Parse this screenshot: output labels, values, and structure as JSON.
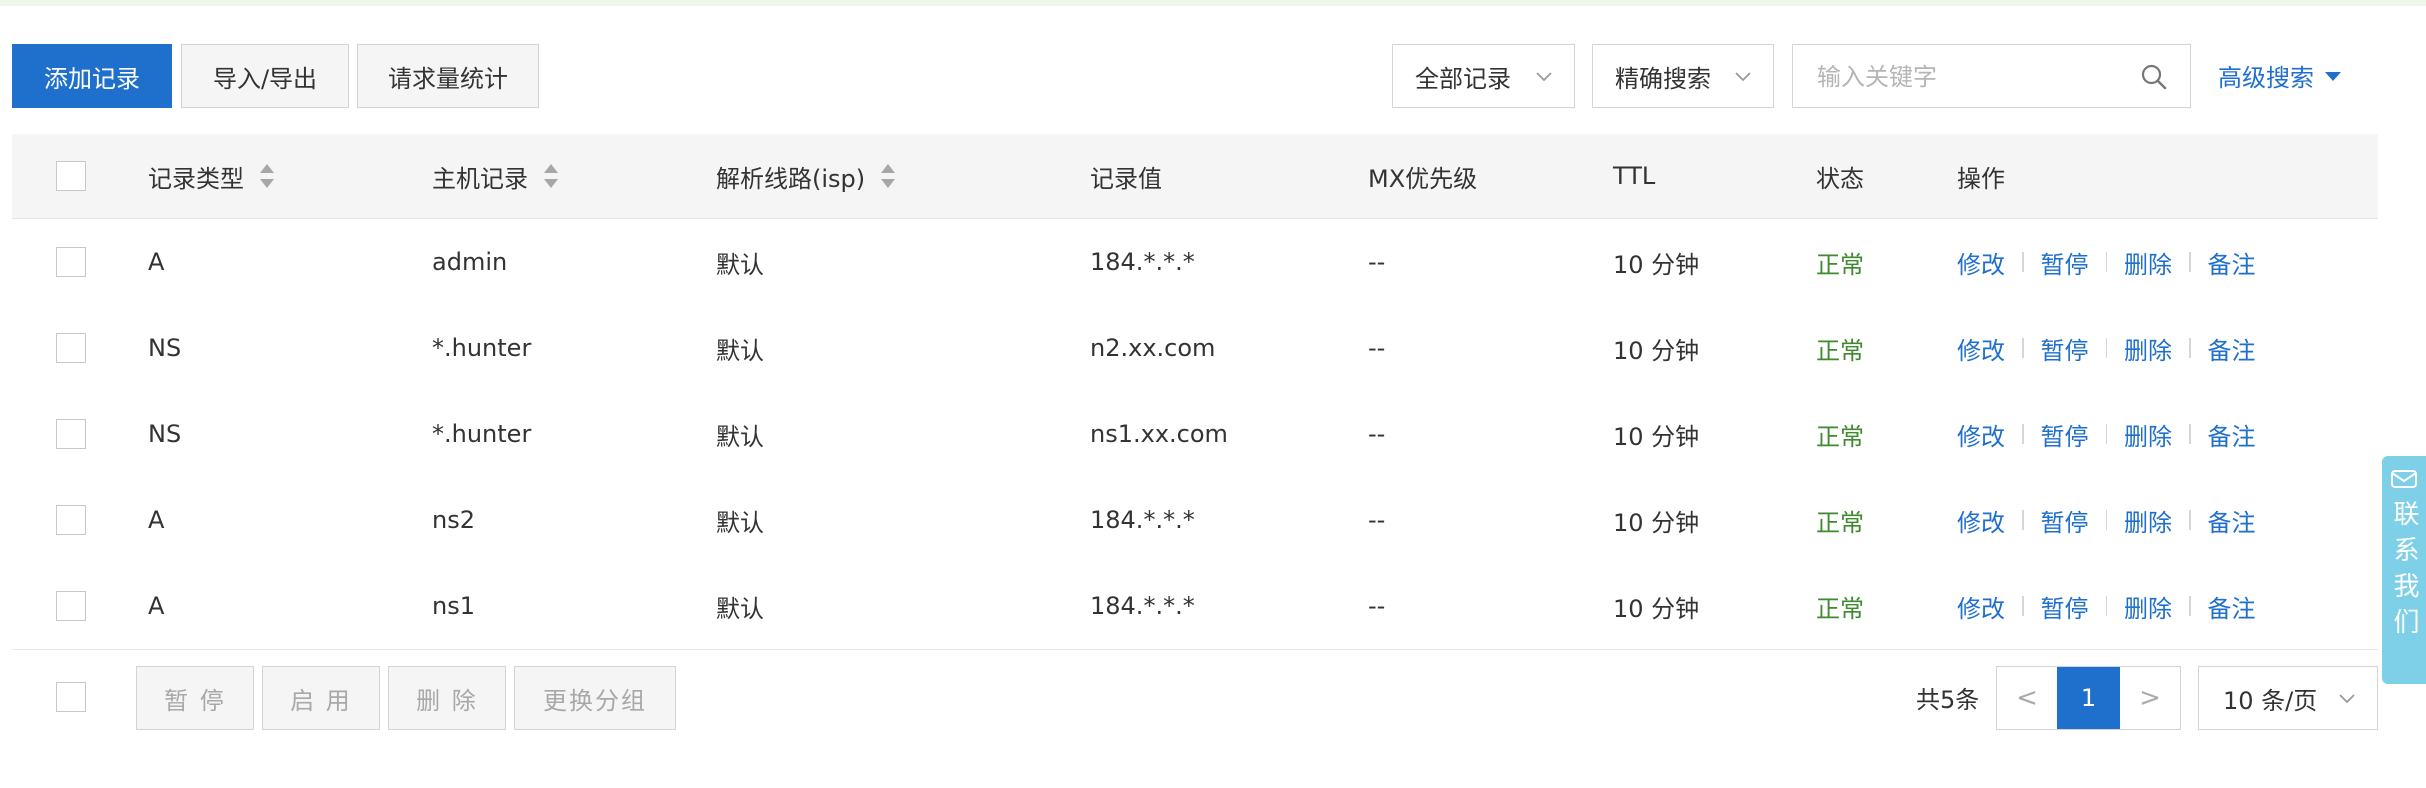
{
  "toolbar": {
    "add_label": "添加记录",
    "import_export_label": "导入/导出",
    "stats_label": "请求量统计",
    "filter_all": "全部记录",
    "filter_mode": "精确搜索",
    "search_placeholder": "输入关键字",
    "advanced_search": "高级搜索"
  },
  "table": {
    "headers": {
      "type": "记录类型",
      "host": "主机记录",
      "line": "解析线路(isp)",
      "value": "记录值",
      "mx": "MX优先级",
      "ttl": "TTL",
      "status": "状态",
      "ops": "操作"
    },
    "rows": [
      {
        "type": "A",
        "host": "admin",
        "line": "默认",
        "value": "184.*.*.*",
        "mx": "--",
        "ttl": "10 分钟",
        "status": "正常"
      },
      {
        "type": "NS",
        "host": "*.hunter",
        "line": "默认",
        "value": "n2.xx.com",
        "mx": "--",
        "ttl": "10 分钟",
        "status": "正常"
      },
      {
        "type": "NS",
        "host": "*.hunter",
        "line": "默认",
        "value": "ns1.xx.com",
        "mx": "--",
        "ttl": "10 分钟",
        "status": "正常"
      },
      {
        "type": "A",
        "host": "ns2",
        "line": "默认",
        "value": "184.*.*.*",
        "mx": "--",
        "ttl": "10 分钟",
        "status": "正常"
      },
      {
        "type": "A",
        "host": "ns1",
        "line": "默认",
        "value": "184.*.*.*",
        "mx": "--",
        "ttl": "10 分钟",
        "status": "正常"
      }
    ],
    "actions": {
      "edit": "修改",
      "pause": "暂停",
      "delete": "删除",
      "note": "备注"
    }
  },
  "footer": {
    "pause": "暂 停",
    "enable": "启 用",
    "delete": "删 除",
    "change_group": "更换分组",
    "total": "共5条",
    "current_page": "1",
    "prev": "<",
    "next": ">",
    "page_size": "10 条/页"
  },
  "contact": {
    "label": "联系我们"
  },
  "colors": {
    "primary": "#1f6fcd",
    "status_ok": "#3f8a2e",
    "contact_bg": "#7ecfe8"
  }
}
